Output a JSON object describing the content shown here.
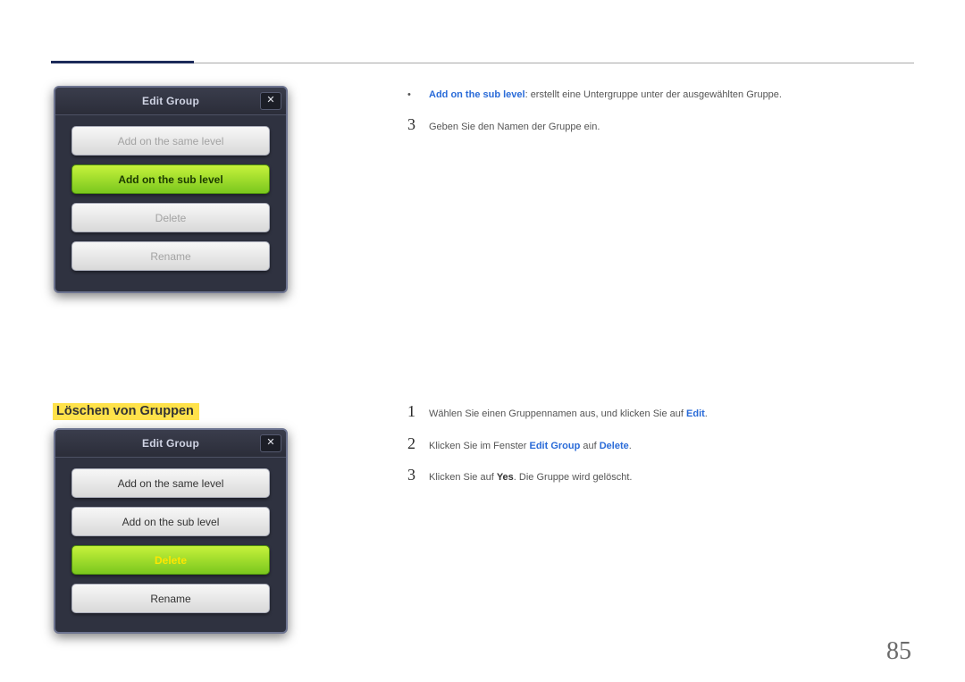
{
  "dialog1": {
    "title": "Edit Group",
    "close": "✕",
    "buttons": {
      "same": "Add on the same level",
      "sub": "Add on the sub level",
      "delete": "Delete",
      "rename": "Rename"
    }
  },
  "dialog2": {
    "title": "Edit Group",
    "close": "✕",
    "buttons": {
      "same": "Add on the same level",
      "sub": "Add on the sub level",
      "delete": "Delete",
      "rename": "Rename"
    }
  },
  "top_right": {
    "bullet_dot": "•",
    "bullet_blue": "Add on the sub level",
    "bullet_rest": ": erstellt eine Untergruppe unter der ausgewählten Gruppe.",
    "step3_num": "3",
    "step3_text": "Geben Sie den Namen der Gruppe ein."
  },
  "section_heading": "Löschen von Gruppen",
  "delete_steps": {
    "s1_num": "1",
    "s1_a": "Wählen Sie einen Gruppennamen aus, und klicken Sie auf ",
    "s1_b": "Edit",
    "s1_c": ".",
    "s2_num": "2",
    "s2_a": "Klicken Sie im Fenster ",
    "s2_b": "Edit Group",
    "s2_c": " auf ",
    "s2_d": "Delete",
    "s2_e": ".",
    "s3_num": "3",
    "s3_a": "Klicken Sie auf ",
    "s3_b": "Yes",
    "s3_c": ". Die Gruppe wird gelöscht."
  },
  "page_number": "85"
}
